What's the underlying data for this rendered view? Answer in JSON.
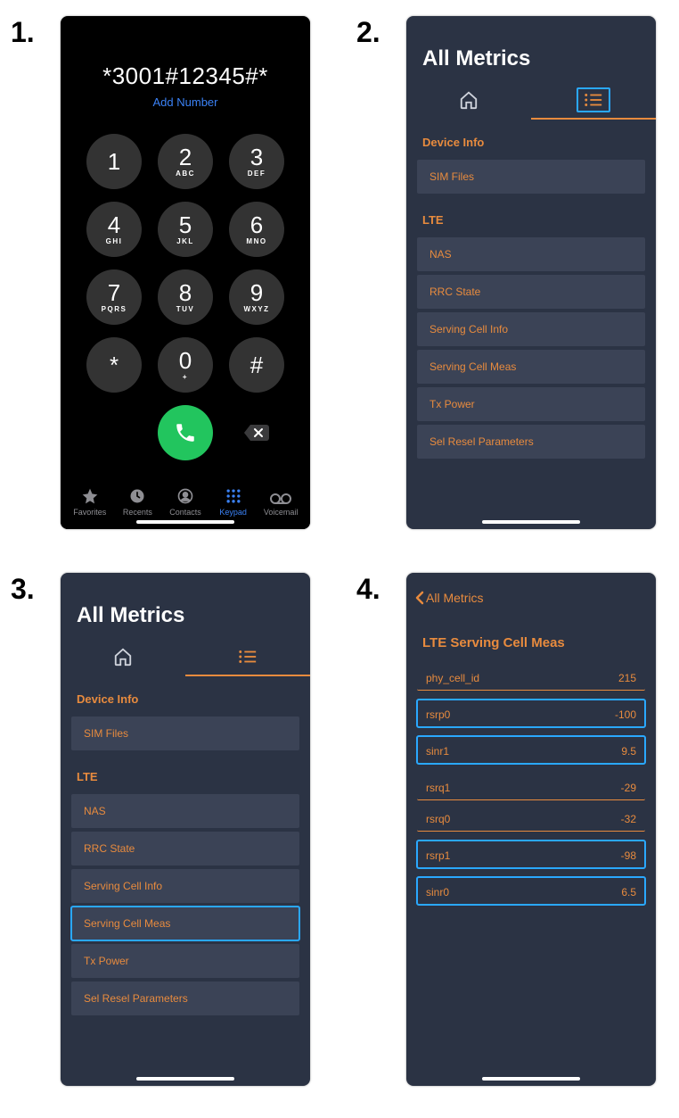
{
  "steps": {
    "s1": "1.",
    "s2": "2.",
    "s3": "3.",
    "s4": "4."
  },
  "dialer": {
    "display_number": "*3001#12345#*",
    "add_number_label": "Add Number",
    "keys": [
      {
        "d": "1",
        "l": ""
      },
      {
        "d": "2",
        "l": "ABC"
      },
      {
        "d": "3",
        "l": "DEF"
      },
      {
        "d": "4",
        "l": "GHI"
      },
      {
        "d": "5",
        "l": "JKL"
      },
      {
        "d": "6",
        "l": "MNO"
      },
      {
        "d": "7",
        "l": "PQRS"
      },
      {
        "d": "8",
        "l": "TUV"
      },
      {
        "d": "9",
        "l": "WXYZ"
      },
      {
        "d": "*",
        "l": ""
      },
      {
        "d": "0",
        "l": "+"
      },
      {
        "d": "#",
        "l": ""
      }
    ],
    "tabs": {
      "favorites": "Favorites",
      "recents": "Recents",
      "contacts": "Contacts",
      "keypad": "Keypad",
      "voicemail": "Voicemail"
    },
    "active_tab": "keypad"
  },
  "metrics2": {
    "title": "All Metrics",
    "sections": [
      {
        "heading": "Device Info",
        "items": [
          "SIM Files"
        ]
      },
      {
        "heading": "LTE",
        "items": [
          "NAS",
          "RRC State",
          "Serving Cell Info",
          "Serving Cell Meas",
          "Tx Power",
          "Sel Resel Parameters"
        ]
      }
    ]
  },
  "metrics3": {
    "title": "All Metrics",
    "sections": [
      {
        "heading": "Device Info",
        "items": [
          "SIM Files"
        ]
      },
      {
        "heading": "LTE",
        "items": [
          "NAS",
          "RRC State",
          "Serving Cell Info",
          "Serving Cell Meas",
          "Tx Power",
          "Sel Resel Parameters"
        ]
      }
    ],
    "highlight_item": "Serving Cell Meas"
  },
  "detail": {
    "back_label": "All Metrics",
    "title": "LTE Serving Cell Meas",
    "rows": [
      {
        "k": "phy_cell_id",
        "v": "215",
        "hl": false
      },
      {
        "k": "rsrp0",
        "v": "-100",
        "hl": true
      },
      {
        "k": "sinr1",
        "v": "9.5",
        "hl": true
      },
      {
        "k": "rsrq1",
        "v": "-29",
        "hl": false
      },
      {
        "k": "rsrq0",
        "v": "-32",
        "hl": false
      },
      {
        "k": "rsrp1",
        "v": "-98",
        "hl": true
      },
      {
        "k": "sinr0",
        "v": "6.5",
        "hl": true
      }
    ]
  }
}
